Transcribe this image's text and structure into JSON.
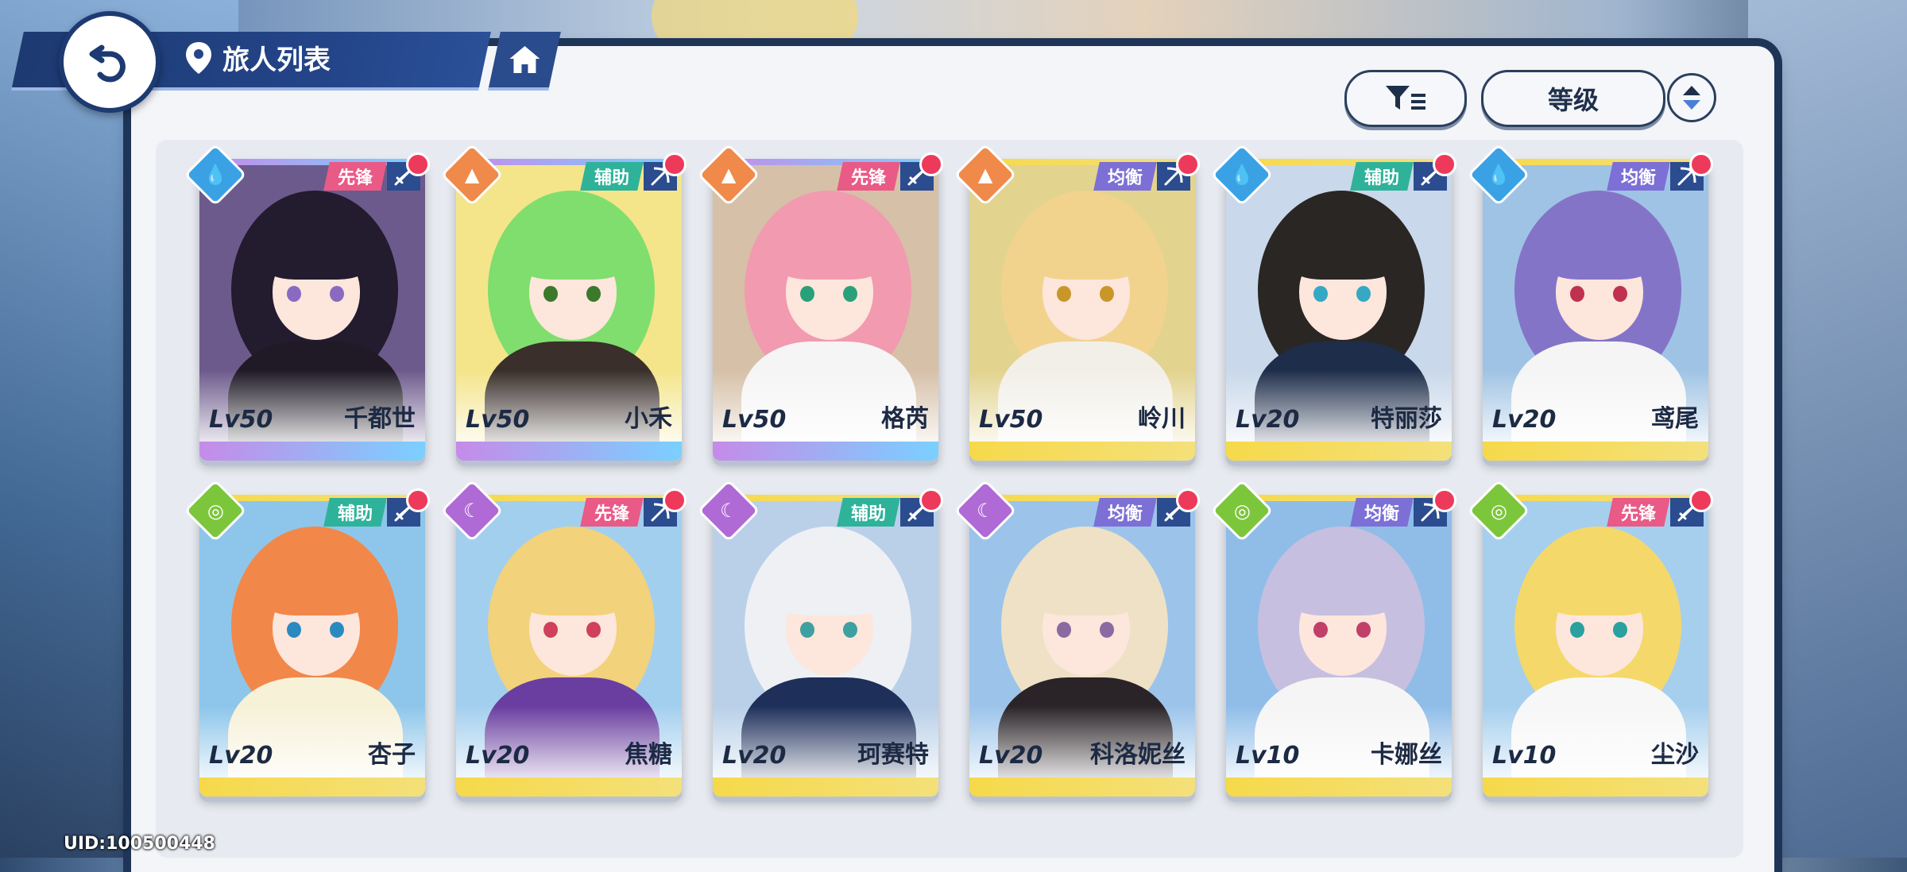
{
  "header": {
    "title": "旅人列表"
  },
  "sort": {
    "label": "等级"
  },
  "uid": "UID:100500448",
  "colors": {
    "vanguard": "#e95a86",
    "support": "#2fb29a",
    "balance": "#7c6fd6",
    "water": "#3aa2e4",
    "earth": "#f08a4a",
    "wind": "#7cc63c",
    "moon": "#b06ad6",
    "notify": "#ee3a5a"
  },
  "characters": [
    {
      "name": "千都世",
      "level": "Lv50",
      "role": "先锋",
      "element": "water",
      "weapon": "sword-icon"
    },
    {
      "name": "小禾",
      "level": "Lv50",
      "role": "辅助",
      "element": "earth",
      "weapon": "bow-icon"
    },
    {
      "name": "格芮",
      "level": "Lv50",
      "role": "先锋",
      "element": "earth",
      "weapon": "sword-icon"
    },
    {
      "name": "岭川",
      "level": "Lv50",
      "role": "均衡",
      "element": "earth",
      "weapon": "bow-icon"
    },
    {
      "name": "特丽莎",
      "level": "Lv20",
      "role": "辅助",
      "element": "water",
      "weapon": "sword-icon"
    },
    {
      "name": "鸢尾",
      "level": "Lv20",
      "role": "均衡",
      "element": "water",
      "weapon": "bow-icon"
    },
    {
      "name": "杏子",
      "level": "Lv20",
      "role": "辅助",
      "element": "wind",
      "weapon": "sword-icon"
    },
    {
      "name": "焦糖",
      "level": "Lv20",
      "role": "先锋",
      "element": "moon",
      "weapon": "bow-icon"
    },
    {
      "name": "珂赛特",
      "level": "Lv20",
      "role": "辅助",
      "element": "moon",
      "weapon": "sword-icon"
    },
    {
      "name": "科洛妮丝",
      "level": "Lv20",
      "role": "均衡",
      "element": "moon",
      "weapon": "sword-icon"
    },
    {
      "name": "卡娜丝",
      "level": "Lv10",
      "role": "均衡",
      "element": "wind",
      "weapon": "bow-icon"
    },
    {
      "name": "尘沙",
      "level": "Lv10",
      "role": "先锋",
      "element": "wind",
      "weapon": "sword-icon"
    }
  ]
}
